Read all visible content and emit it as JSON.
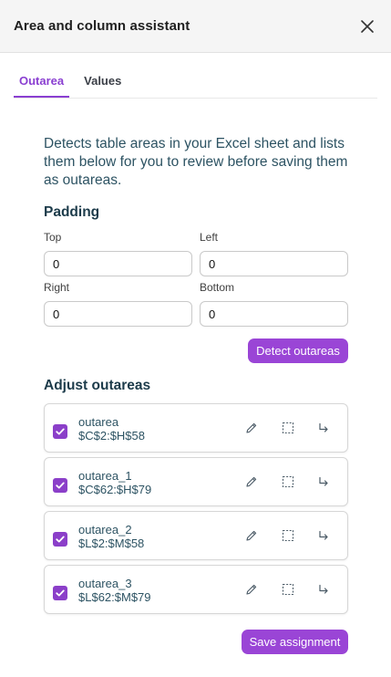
{
  "header": {
    "title": "Area and column assistant",
    "close_icon": "close-icon"
  },
  "tabs": [
    {
      "label": "Outarea",
      "active": true
    },
    {
      "label": "Values",
      "active": false
    }
  ],
  "description": "Detects table areas in your Excel sheet and lists them below for you to review before saving them as outareas.",
  "padding": {
    "title": "Padding",
    "fields": {
      "top": {
        "label": "Top",
        "value": "0"
      },
      "left": {
        "label": "Left",
        "value": "0"
      },
      "right": {
        "label": "Right",
        "value": "0"
      },
      "bottom": {
        "label": "Bottom",
        "value": "0"
      }
    }
  },
  "detect_button": {
    "label": "Detect outareas"
  },
  "adjust": {
    "title": "Adjust outareas",
    "items": [
      {
        "name": "outarea",
        "range": "$C$2:$H$58",
        "checked": true
      },
      {
        "name": "outarea_1",
        "range": "$C$62:$H$79",
        "checked": true
      },
      {
        "name": "outarea_2",
        "range": "$L$2:$M$58",
        "checked": true
      },
      {
        "name": "outarea_3",
        "range": "$L$62:$M$79",
        "checked": true
      }
    ],
    "item_icons": [
      "pencil-icon",
      "select-range-icon",
      "go-to-icon"
    ]
  },
  "save_button": {
    "label": "Save assignment"
  },
  "colors": {
    "accent": "#9a45d6",
    "text_teal": "#2d5363",
    "header_bg": "#f5f5f5"
  }
}
